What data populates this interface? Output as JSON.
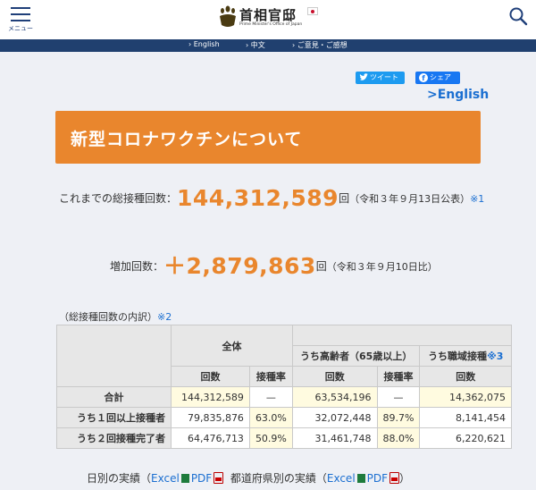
{
  "header": {
    "menu_label": "メニュー",
    "site_title": "首相官邸",
    "site_subtitle": "Prime Minister's Office of Japan"
  },
  "nav": {
    "items": [
      "English",
      "中文",
      "ご意見・ご感想"
    ]
  },
  "share": {
    "tweet_label": "ツイート",
    "facebook_label": "シェア",
    "english_link": ">English"
  },
  "title": "新型コロナワクチンについて",
  "total": {
    "label": "これまでの総接種回数：",
    "value": "144,312,589",
    "unit": "回",
    "note": "（令和３年９月13日公表）",
    "ref": "※1"
  },
  "increase": {
    "label": "増加回数：",
    "value": "＋2,879,863",
    "unit": "回",
    "note": "（令和３年９月10日比）"
  },
  "breakdown": {
    "caption": "（総接種回数の内訳）",
    "ref": "※2",
    "group_headers": {
      "all": "全体",
      "elderly": "うち高齢者（65歳以上）",
      "workplace": "うち職域接種",
      "workplace_ref": "※3"
    },
    "sub_headers": {
      "count": "回数",
      "rate": "接種率"
    },
    "rows": [
      {
        "label": "合計",
        "all_count": "144,312,589",
        "all_rate": "—",
        "eld_count": "63,534,196",
        "eld_rate": "—",
        "work_count": "14,362,075"
      },
      {
        "label": "うち１回以上接種者",
        "all_count": "79,835,876",
        "all_rate": "63.0%",
        "eld_count": "32,072,448",
        "eld_rate": "89.7%",
        "work_count": "8,141,454"
      },
      {
        "label": "うち２回接種完了者",
        "all_count": "64,476,713",
        "all_rate": "50.9%",
        "eld_count": "31,461,748",
        "eld_rate": "88.0%",
        "work_count": "6,220,621"
      }
    ]
  },
  "footer": {
    "daily_label": "日別の実績（",
    "pref_label": "都道府県別の実績（",
    "excel": "Excel",
    "pdf": "PDF",
    "close": "）"
  },
  "colors": {
    "accent": "#e9862d",
    "navy": "#20406f",
    "link": "#1b6fd1",
    "highlight": "#fffbe0"
  }
}
